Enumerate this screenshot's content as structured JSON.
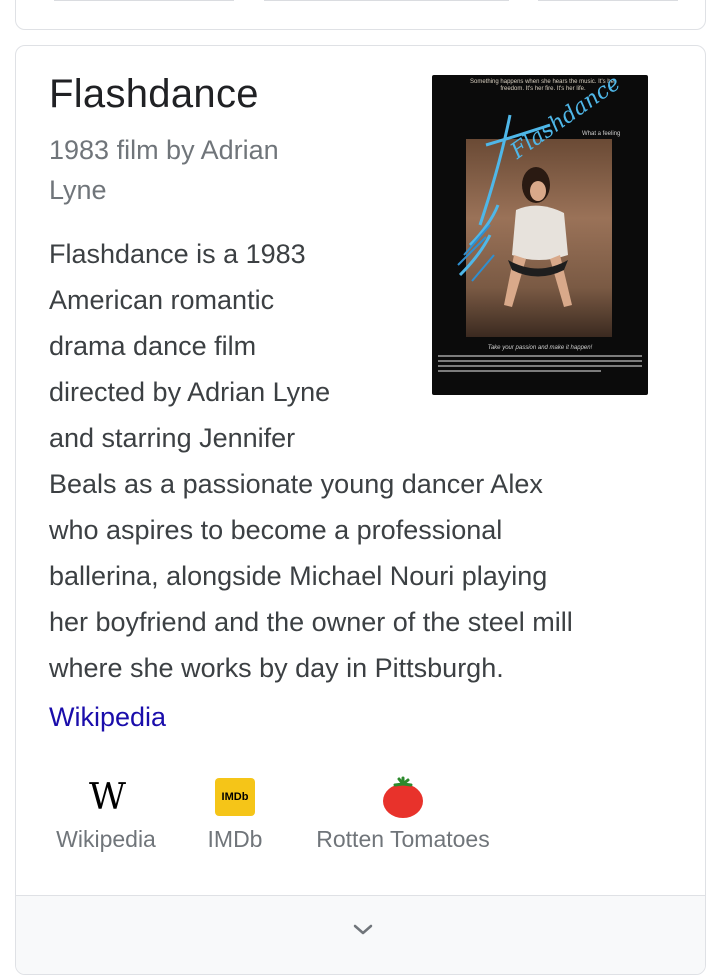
{
  "panel": {
    "title": "Flashdance",
    "subtitle_lines": [
      "1983 film by Adrian",
      "Lyne"
    ],
    "description_lines": [
      "Flashdance is a 1983",
      "American romantic",
      "drama dance film",
      "directed by Adrian Lyne",
      "and starring Jennifer",
      "Beals as a passionate young dancer Alex",
      "who aspires to become a professional",
      "ballerina, alongside Michael Nouri playing",
      "her boyfriend and the owner of the steel mill",
      "where she works by day in Pittsburgh."
    ],
    "source_link": "Wikipedia",
    "poster": {
      "tagline": "Something happens when she hears the music. It's her freedom. It's her fire. It's her life.",
      "logo": "Flashdance",
      "caption": "Take your passion and make it happen!",
      "small_text": "What a feeling"
    }
  },
  "profiles": [
    {
      "label": "Wikipedia",
      "icon": "wikipedia-icon",
      "glyph": "W"
    },
    {
      "label": "IMDb",
      "icon": "imdb-icon",
      "glyph": "IMDb"
    },
    {
      "label": "Rotten Tomatoes",
      "icon": "tomato-icon",
      "glyph": ""
    }
  ],
  "colors": {
    "link": "#1a0dab",
    "imdb": "#f5c518",
    "tomato": "#e8322b"
  }
}
